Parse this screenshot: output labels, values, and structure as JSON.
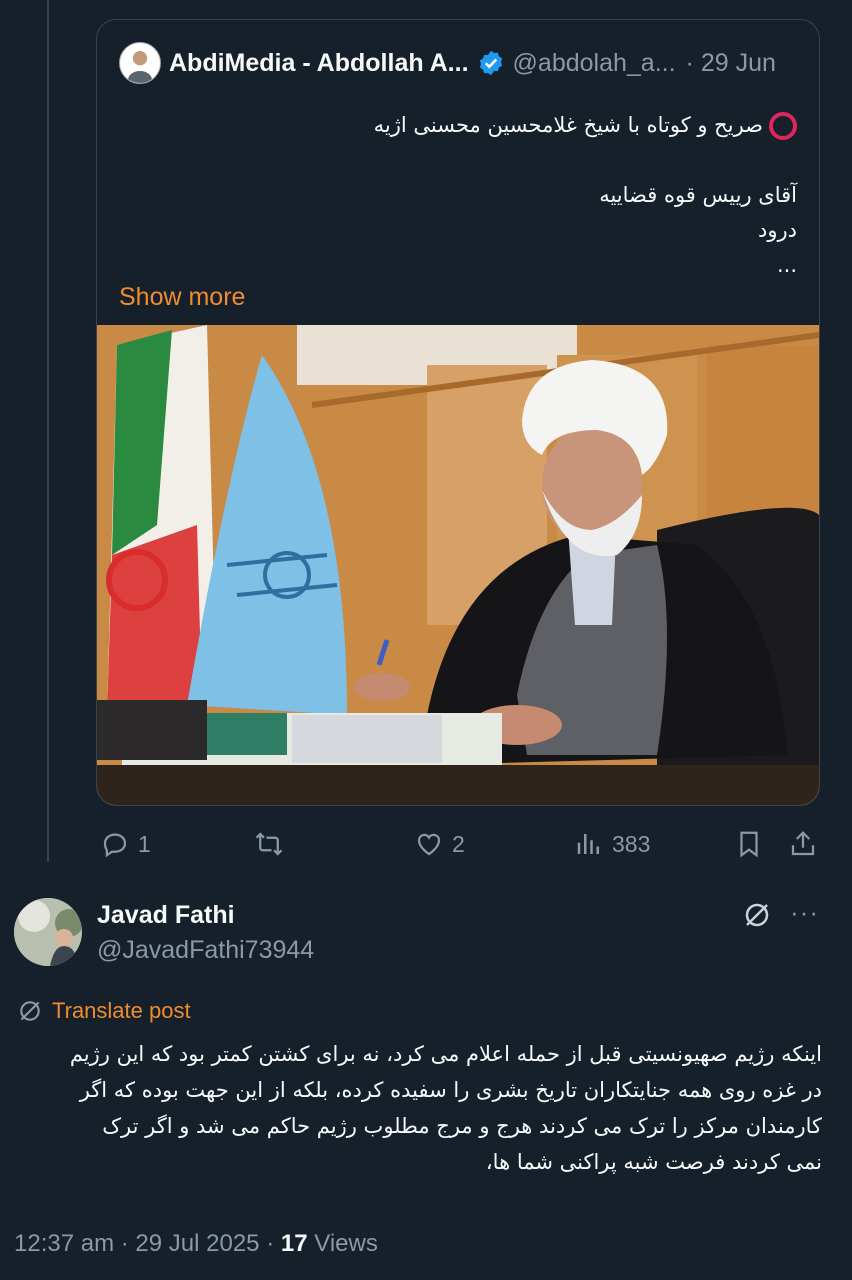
{
  "quoted_post": {
    "author_name": "AbdiMedia - Abdollah A...",
    "author_handle": "@abdolah_a...",
    "date": "· 29 Jun",
    "lines": [
      "صریح و کوتاه با شیخ غلامحسین محسنی اژیه",
      "",
      "آقای رییس قوه قضاییه",
      "درود",
      "..."
    ],
    "show_more": "Show more",
    "image_alt": "photo"
  },
  "actions": {
    "replies": "1",
    "reposts": "",
    "likes": "2",
    "views": "383"
  },
  "reply": {
    "author_name": "Javad Fathi",
    "author_handle": "@JavadFathi73944",
    "more": "···",
    "translate_label": "Translate post",
    "lines": [
      "اینکه رژیم صهیونسیتی قبل از حمله  اعلام می کرد، نه برای کشتن کمتر بود که این رژیم",
      "در غزه روی همه جنایتکاران تاریخ بشری را سفیده کرده، بلکه از این جهت بوده که اگر",
      "کارمندان مرکز را ترک می کردند هرج و مرج مطلوب رژیم حاکم می شد و اگر ترک",
      "نمی کردند فرصت شبه پراکنی شما ها،"
    ],
    "time": "12:37 am",
    "date": "29 Jul 2025",
    "views_count": "17",
    "views_label": "Views"
  },
  "colors": {
    "background": "#15202b",
    "accent_orange": "#f08c2e",
    "muted": "#8b98a5",
    "verified_blue": "#1d9bf0"
  },
  "icons": [
    "verified-icon",
    "red-circle-icon",
    "reply-icon",
    "repost-icon",
    "like-icon",
    "views-icon",
    "bookmark-icon",
    "share-icon",
    "grok-icon",
    "translate-icon"
  ]
}
